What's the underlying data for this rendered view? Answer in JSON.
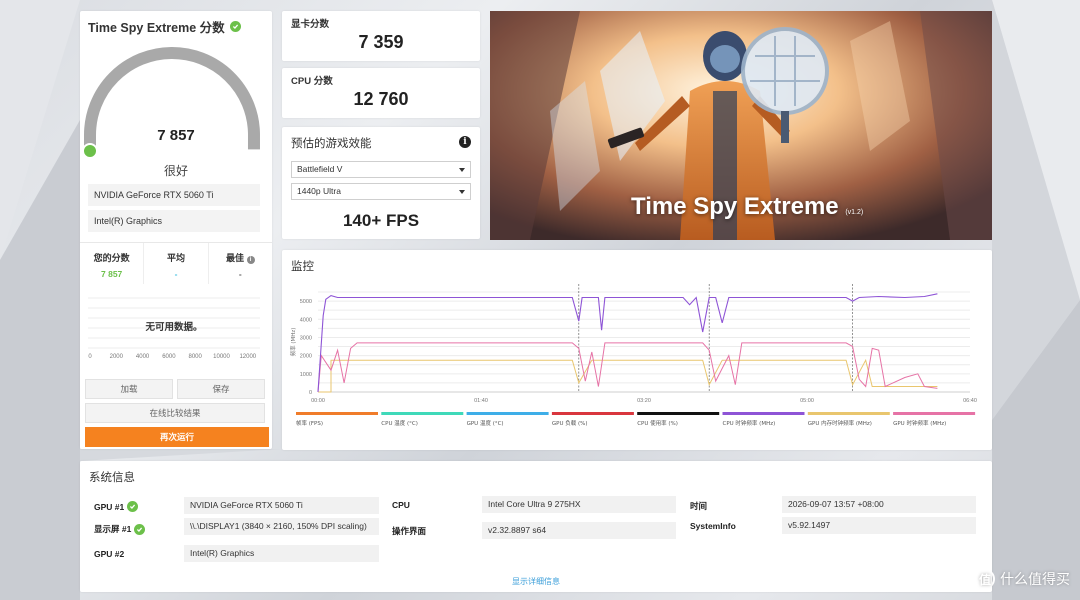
{
  "score_card": {
    "title": "Time Spy Extreme 分数",
    "score": "7 857",
    "score_fraction": 0.86,
    "grade": "很好",
    "gpu_name": "NVIDIA GeForce RTX 5060 Ti",
    "igpu_name": "Intel(R) Graphics",
    "compare": {
      "your_label": "您的分数",
      "your_value": "7 857",
      "avg_label": "平均",
      "avg_value": "-",
      "best_label": "最佳",
      "best_value": "-"
    },
    "no_data": "无可用数据。",
    "axis_ticks": [
      "0",
      "2000",
      "4000",
      "6000",
      "8000",
      "10000",
      "12000"
    ],
    "load_button": "加载",
    "save_button": "保存",
    "compare_online_button": "在线比较结果",
    "run_again_button": "再次运行"
  },
  "graphics_score": {
    "label": "显卡分数",
    "value": "7 359"
  },
  "cpu_score": {
    "label": "CPU 分数",
    "value": "12 760"
  },
  "game_perf": {
    "label": "预估的游戏效能",
    "game": "Battlefield V",
    "preset": "1440p Ultra",
    "fps": "140+ FPS"
  },
  "hero": {
    "title": "Time Spy Extreme",
    "version": "(v1.2)"
  },
  "monitor": {
    "label": "监控",
    "y_axis_label": "频率 (MHz)",
    "y_ticks": [
      "5000",
      "4000",
      "3000",
      "2000",
      "1000",
      "0"
    ],
    "x_ticks": [
      "00:00",
      "01:40",
      "03:20",
      "05:00",
      "06:40"
    ],
    "legend": [
      {
        "name": "帧率 (FPS)",
        "color": "#f07c2a"
      },
      {
        "name": "CPU 温度 (°C)",
        "color": "#3fd9b9"
      },
      {
        "name": "GPU 温度 (°C)",
        "color": "#3eaee8"
      },
      {
        "name": "GPU 负载 (%)",
        "color": "#d9363e"
      },
      {
        "name": "CPU 使用率 (%)",
        "color": "#111111"
      },
      {
        "name": "CPU 时钟频率 (MHz)",
        "color": "#8e54d6"
      },
      {
        "name": "GPU 内存时钟频率 (MHz)",
        "color": "#e9c66e"
      },
      {
        "name": "GPU 时钟频率 (MHz)",
        "color": "#e673a6"
      }
    ],
    "chart_data": {
      "type": "line",
      "xlabel": "",
      "ylabel": "频率 (MHz)",
      "x_range": [
        "00:00",
        "06:40"
      ],
      "ylim": [
        0,
        5500
      ],
      "grid": true,
      "series": [
        {
          "name": "CPU 时钟频率 (MHz)",
          "approx_level": 5200
        },
        {
          "name": "GPU 时钟频率 (MHz)",
          "approx_level": 2700
        },
        {
          "name": "GPU 内存时钟频率 (MHz)",
          "approx_level": 1750
        }
      ]
    }
  },
  "system_info": {
    "label": "系统信息",
    "gpu1_key": "GPU #1",
    "gpu1_val": "NVIDIA GeForce RTX 5060 Ti",
    "display_key": "显示屏 #1",
    "display_val": "\\\\.\\DISPLAY1 (3840 × 2160, 150% DPI scaling)",
    "gpu2_key": "GPU #2",
    "gpu2_val": "Intel(R) Graphics",
    "cpu_key": "CPU",
    "cpu_val": "Intel Core Ultra 9 275HX",
    "os_key": "操作界面",
    "os_val": "v2.32.8897 s64",
    "time_key": "时间",
    "time_val": "2026-09-07 13:57 +08:00",
    "sysinfo_key": "SystemInfo",
    "sysinfo_val": "v5.92.1497",
    "detail_link": "显示详细信息"
  },
  "watermark": {
    "text": "什么值得买",
    "logo": "值"
  },
  "colors": {
    "accent_orange": "#f5821f",
    "score_green": "#6cc04a",
    "gauge_gray": "#a9a9a9"
  }
}
